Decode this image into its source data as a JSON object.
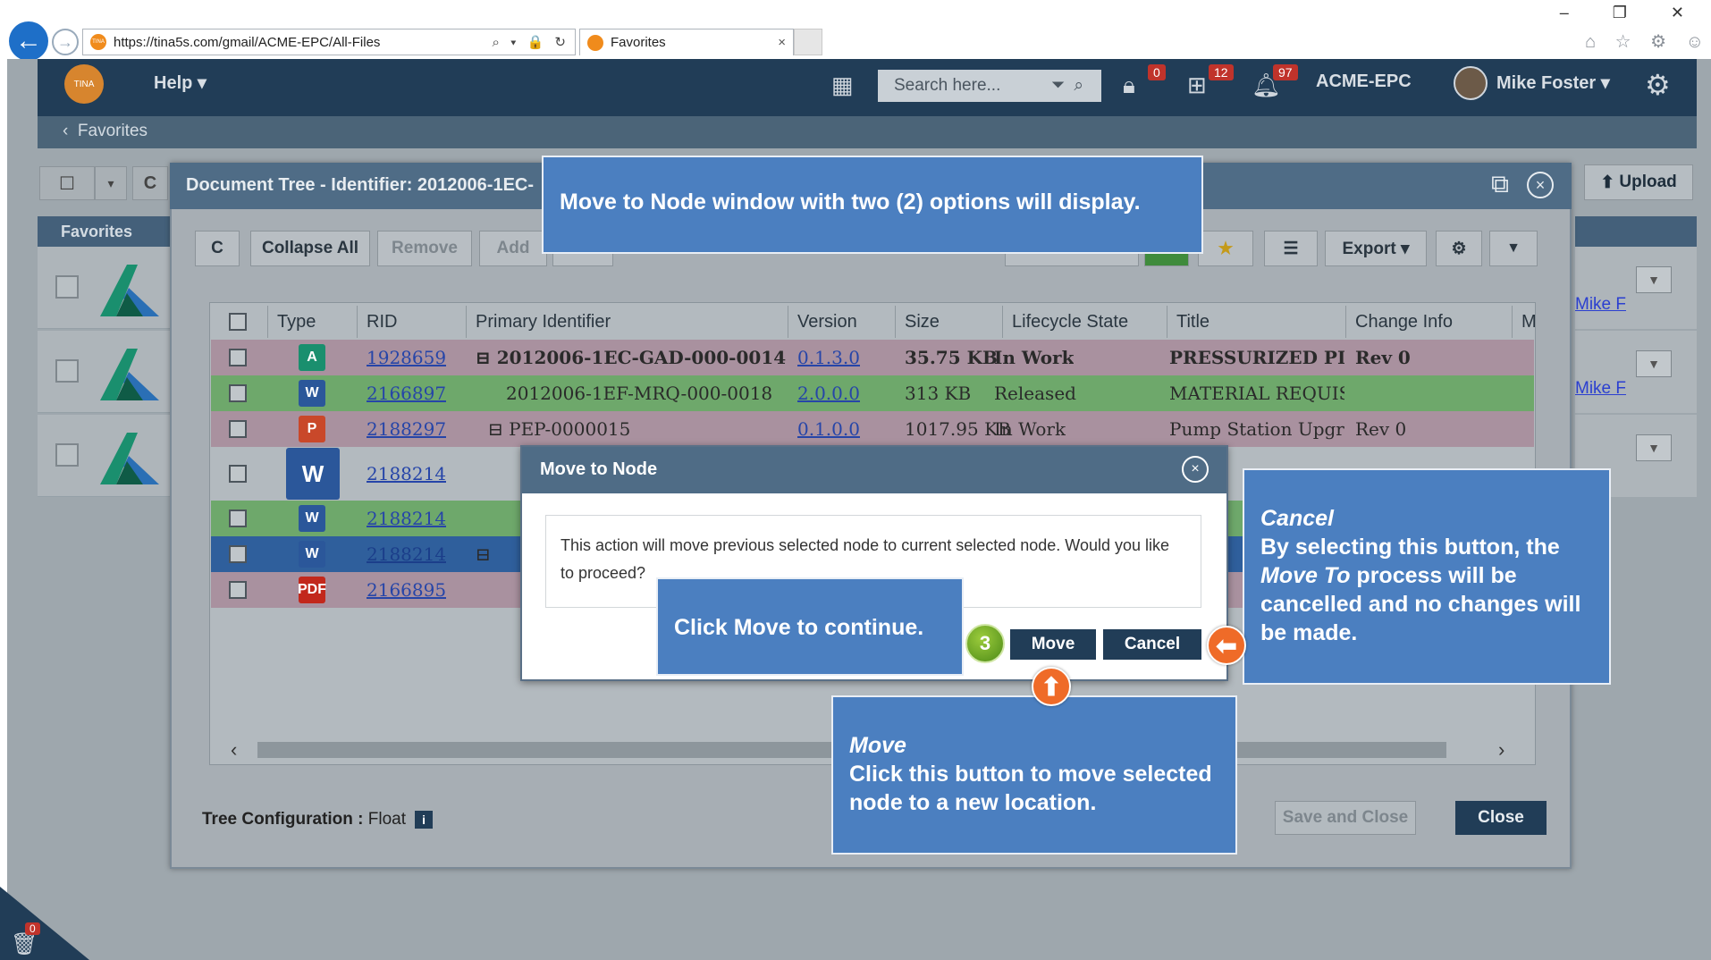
{
  "browser": {
    "url": "https://tina5s.com/gmail/ACME-EPC/All-Files",
    "tab_title": "Favorites",
    "tab_close": "×",
    "window_controls": "–  ❐  ✕",
    "addr_tools": "⌕ ▾ 🔒 ↻",
    "right_icons": "⌂ ☆ ⚙ ☺",
    "icons": [
      "back-arrow-icon",
      "forward-arrow-icon",
      "search-icon",
      "lock-icon",
      "refresh-icon",
      "home-icon",
      "star-icon",
      "gear-icon",
      "smiley-icon"
    ]
  },
  "app": {
    "logo_text": "TINA",
    "help_label": "Help ▾",
    "search_placeholder": "Search here...",
    "lock_badge": "0",
    "org_badge": "12",
    "bell_badge": "97",
    "org_name": "ACME-EPC",
    "user_name": "Mike Foster ▾",
    "subnav_label": "Favorites",
    "favorites_header": "Favorites",
    "upload_label": "Upload",
    "user_link": "Mike F",
    "trash_badge": "0"
  },
  "doc_tree": {
    "title": "Document Tree - Identifier: 2012006-1EC-",
    "toolbar": {
      "refresh": "C",
      "collapse_all": "Collapse All",
      "remove": "Remove",
      "add": "Add",
      "export": "Export ▾"
    },
    "columns": [
      "Type",
      "RID",
      "Primary Identifier",
      "Version",
      "Size",
      "Lifecycle State",
      "Title",
      "Change Info",
      "M"
    ],
    "rows": [
      {
        "type": "A",
        "rid": "1928659",
        "pid": "⊟ 2012006-1EC-GAD-000-0014",
        "version": "0.1.3.0",
        "size": "35.75 KB",
        "state": "In Work",
        "title": "PRESSURIZED PIP",
        "change": "Rev 0",
        "bg": "#a9919f",
        "bold": true
      },
      {
        "type": "W",
        "rid": "2166897",
        "pid": "2012006-1EF-MRQ-000-0018",
        "version": "2.0.0.0",
        "size": "313 KB",
        "state": "Released",
        "title": "MATERIAL REQUISIT",
        "change": "",
        "bg": "#6ea86b",
        "bold": false
      },
      {
        "type": "P",
        "rid": "2188297",
        "pid": "⊟ PEP-0000015",
        "version": "0.1.0.0",
        "size": "1017.95 KB",
        "state": "In Work",
        "title": "Pump Station Upgra",
        "change": "Rev 0",
        "bg": "#a9919f",
        "bold": false
      },
      {
        "type": "W",
        "rid": "2188214",
        "pid": "",
        "version": "",
        "size": "",
        "state": "",
        "title": "",
        "change": "",
        "bg": "#b3babf",
        "bold": false
      },
      {
        "type": "W",
        "rid": "2188214",
        "pid": "",
        "version": "",
        "size": "",
        "state": "",
        "title": "",
        "change": "",
        "bg": "#6ea86b",
        "bold": false
      },
      {
        "type": "W",
        "rid": "2188214",
        "pid": "⊟",
        "version": "",
        "size": "",
        "state": "",
        "title": "",
        "change": "",
        "bg": "#2f5f9c",
        "bold": false
      },
      {
        "type": "PDF",
        "rid": "2166895",
        "pid": "",
        "version": "",
        "size": "",
        "state": "",
        "title": "",
        "change": "",
        "bg": "#a9919f",
        "bold": false
      }
    ],
    "tree_config_label": "Tree Configuration :",
    "tree_config_value": "Float",
    "info_icon": "i",
    "save_close": "Save and Close",
    "close": "Close"
  },
  "modal": {
    "title": "Move to Node",
    "close_icon": "×",
    "message": "This action will move previous selected node to current selected node. Would you like to proceed?",
    "move_label": "Move",
    "cancel_label": "Cancel"
  },
  "callouts": {
    "top": "Move to Node window with two (2) options will display.",
    "click_move": "Click Move to continue.",
    "step_number": "3",
    "cancel_title": "Cancel",
    "cancel_body_1": "By selecting this button, the",
    "cancel_body_em": "Move To",
    "cancel_body_2": "process will be cancelled and no changes will be made.",
    "move_title": "Move",
    "move_body": "Click this button to move selected node to a new location.",
    "arrow_left": "⬅",
    "arrow_up": "⬆"
  },
  "colors": {
    "nav": "#213d57",
    "callout": "#4b7fc0",
    "arrow": "#ef6b28",
    "step": "#5ea22a"
  }
}
